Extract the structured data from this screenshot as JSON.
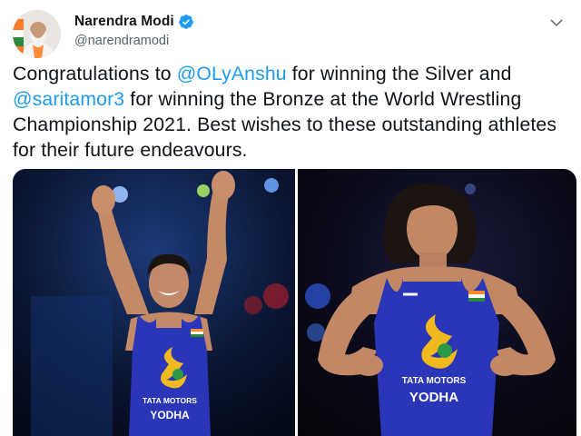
{
  "author": {
    "display_name": "Narendra Modi",
    "handle": "@narendramodi",
    "verified": true,
    "avatar_icon": "profile-photo"
  },
  "tweet": {
    "text_before_1": "Congratulations to ",
    "mention_1": "@OLyAnshu",
    "text_after_1": " for winning the Silver and ",
    "mention_2": "@saritamor3",
    "text_after_2": " for winning the Bronze at the World Wrestling Championship 2021. Best wishes to these outstanding athletes for their future endeavours."
  },
  "media": {
    "left": {
      "jersey_line_1": "TATA MOTORS",
      "jersey_line_2": "YODHA"
    },
    "right": {
      "jersey_line_1": "TATA MOTORS",
      "jersey_line_2": "YODHA"
    }
  },
  "colors": {
    "mention": "#1d9bf0",
    "verified_badge": "#1d9bf0",
    "text": "#0f1419",
    "handle": "#536471",
    "jersey": "#2a35b8"
  }
}
